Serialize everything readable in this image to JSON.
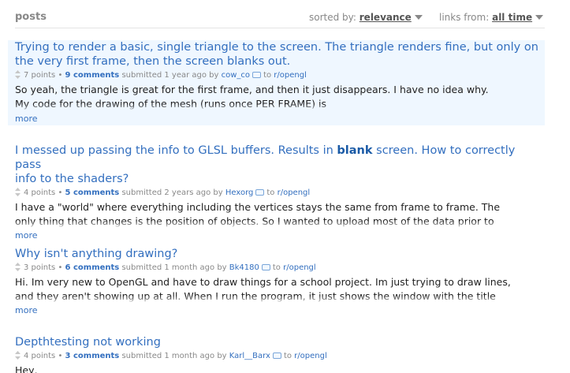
{
  "header": {
    "title": "posts",
    "sort_label": "sorted by:",
    "sort_value": "relevance",
    "links_label": "links from:",
    "links_value": "all time"
  },
  "results": [
    {
      "title_lines": [
        "Trying to render a basic, single triangle to the screen. The triangle renders fine, but only on",
        "the very first frame, then the screen blanks out."
      ],
      "points": "7 points",
      "comments": "9 comments",
      "submitted": "submitted 1 year ago by",
      "author": "cow_co",
      "to": "to",
      "subreddit": "r/opengl",
      "body_lines": [
        "So yeah, the triangle is great for the first frame, and then it just disappears. I have no idea why.",
        "My code for the drawing of the mesh (runs once PER FRAME) is"
      ],
      "more": "more"
    },
    {
      "title_pre": "I messed up passing the info to GLSL buffers. Results in ",
      "title_bold": "blank",
      "title_post": " screen. How to correctly pass",
      "title_line2": "info to the shaders?",
      "points": "4 points",
      "comments": "5 comments",
      "submitted": "submitted 2 years ago by",
      "author": "Hexorg",
      "to": "to",
      "subreddit": "r/opengl",
      "body_lines": [
        "I have a \"world\" where everything including the vertices stays the same from frame to frame. The",
        "only thing that changes is the position of objects. So I wanted to upload most of the data prior to"
      ],
      "more": "more"
    },
    {
      "title_lines": [
        "Why isn't anything drawing?"
      ],
      "points": "3 points",
      "comments": "6 comments",
      "submitted": "submitted 1 month ago by",
      "author": "Bk4180",
      "to": "to",
      "subreddit": "r/opengl",
      "body_lines": [
        "Hi. Im very new to OpenGL and have to draw things for a school project. Im just trying to draw lines,",
        "and they aren't showing up at all. When I run the program, it just shows the window with the title"
      ],
      "more": "more"
    },
    {
      "title_lines": [
        "Depthtesting not working"
      ],
      "points": "4 points",
      "comments": "3 comments",
      "submitted": "submitted 1 month ago by",
      "author": "Karl__Barx",
      "to": "to",
      "subreddit": "r/opengl",
      "body_lines": [
        "Hey,"
      ]
    }
  ],
  "icons": {
    "vote": "vote-arrows-icon",
    "subreddit": "subreddit-icon",
    "caret": "caret-down-icon"
  },
  "colors": {
    "link": "#336fbf",
    "highlight_bg": "#eff7ff",
    "meta": "#888888"
  }
}
